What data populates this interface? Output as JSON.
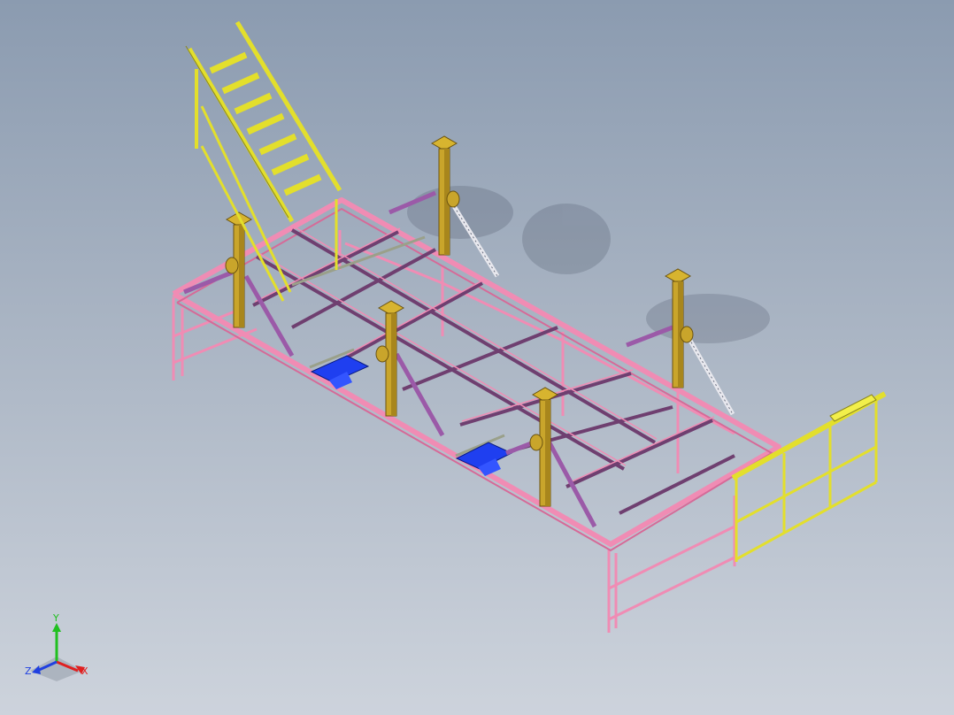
{
  "viewport": {
    "background_top": "#8b9bb0",
    "background_bottom": "#cdd3dc"
  },
  "model": {
    "frame_color": "#f08cb4",
    "column_color": "#c9a52b",
    "ladder_color": "#f2ef4a",
    "brace_color": "#9b5aa8",
    "pad_color": "#1f3ff0"
  },
  "triad": {
    "x_label": "X",
    "y_label": "Y",
    "z_label": "Z",
    "x_color": "#e02020",
    "y_color": "#20c020",
    "z_color": "#2040e0",
    "icon": "coordinate-triad-icon"
  }
}
